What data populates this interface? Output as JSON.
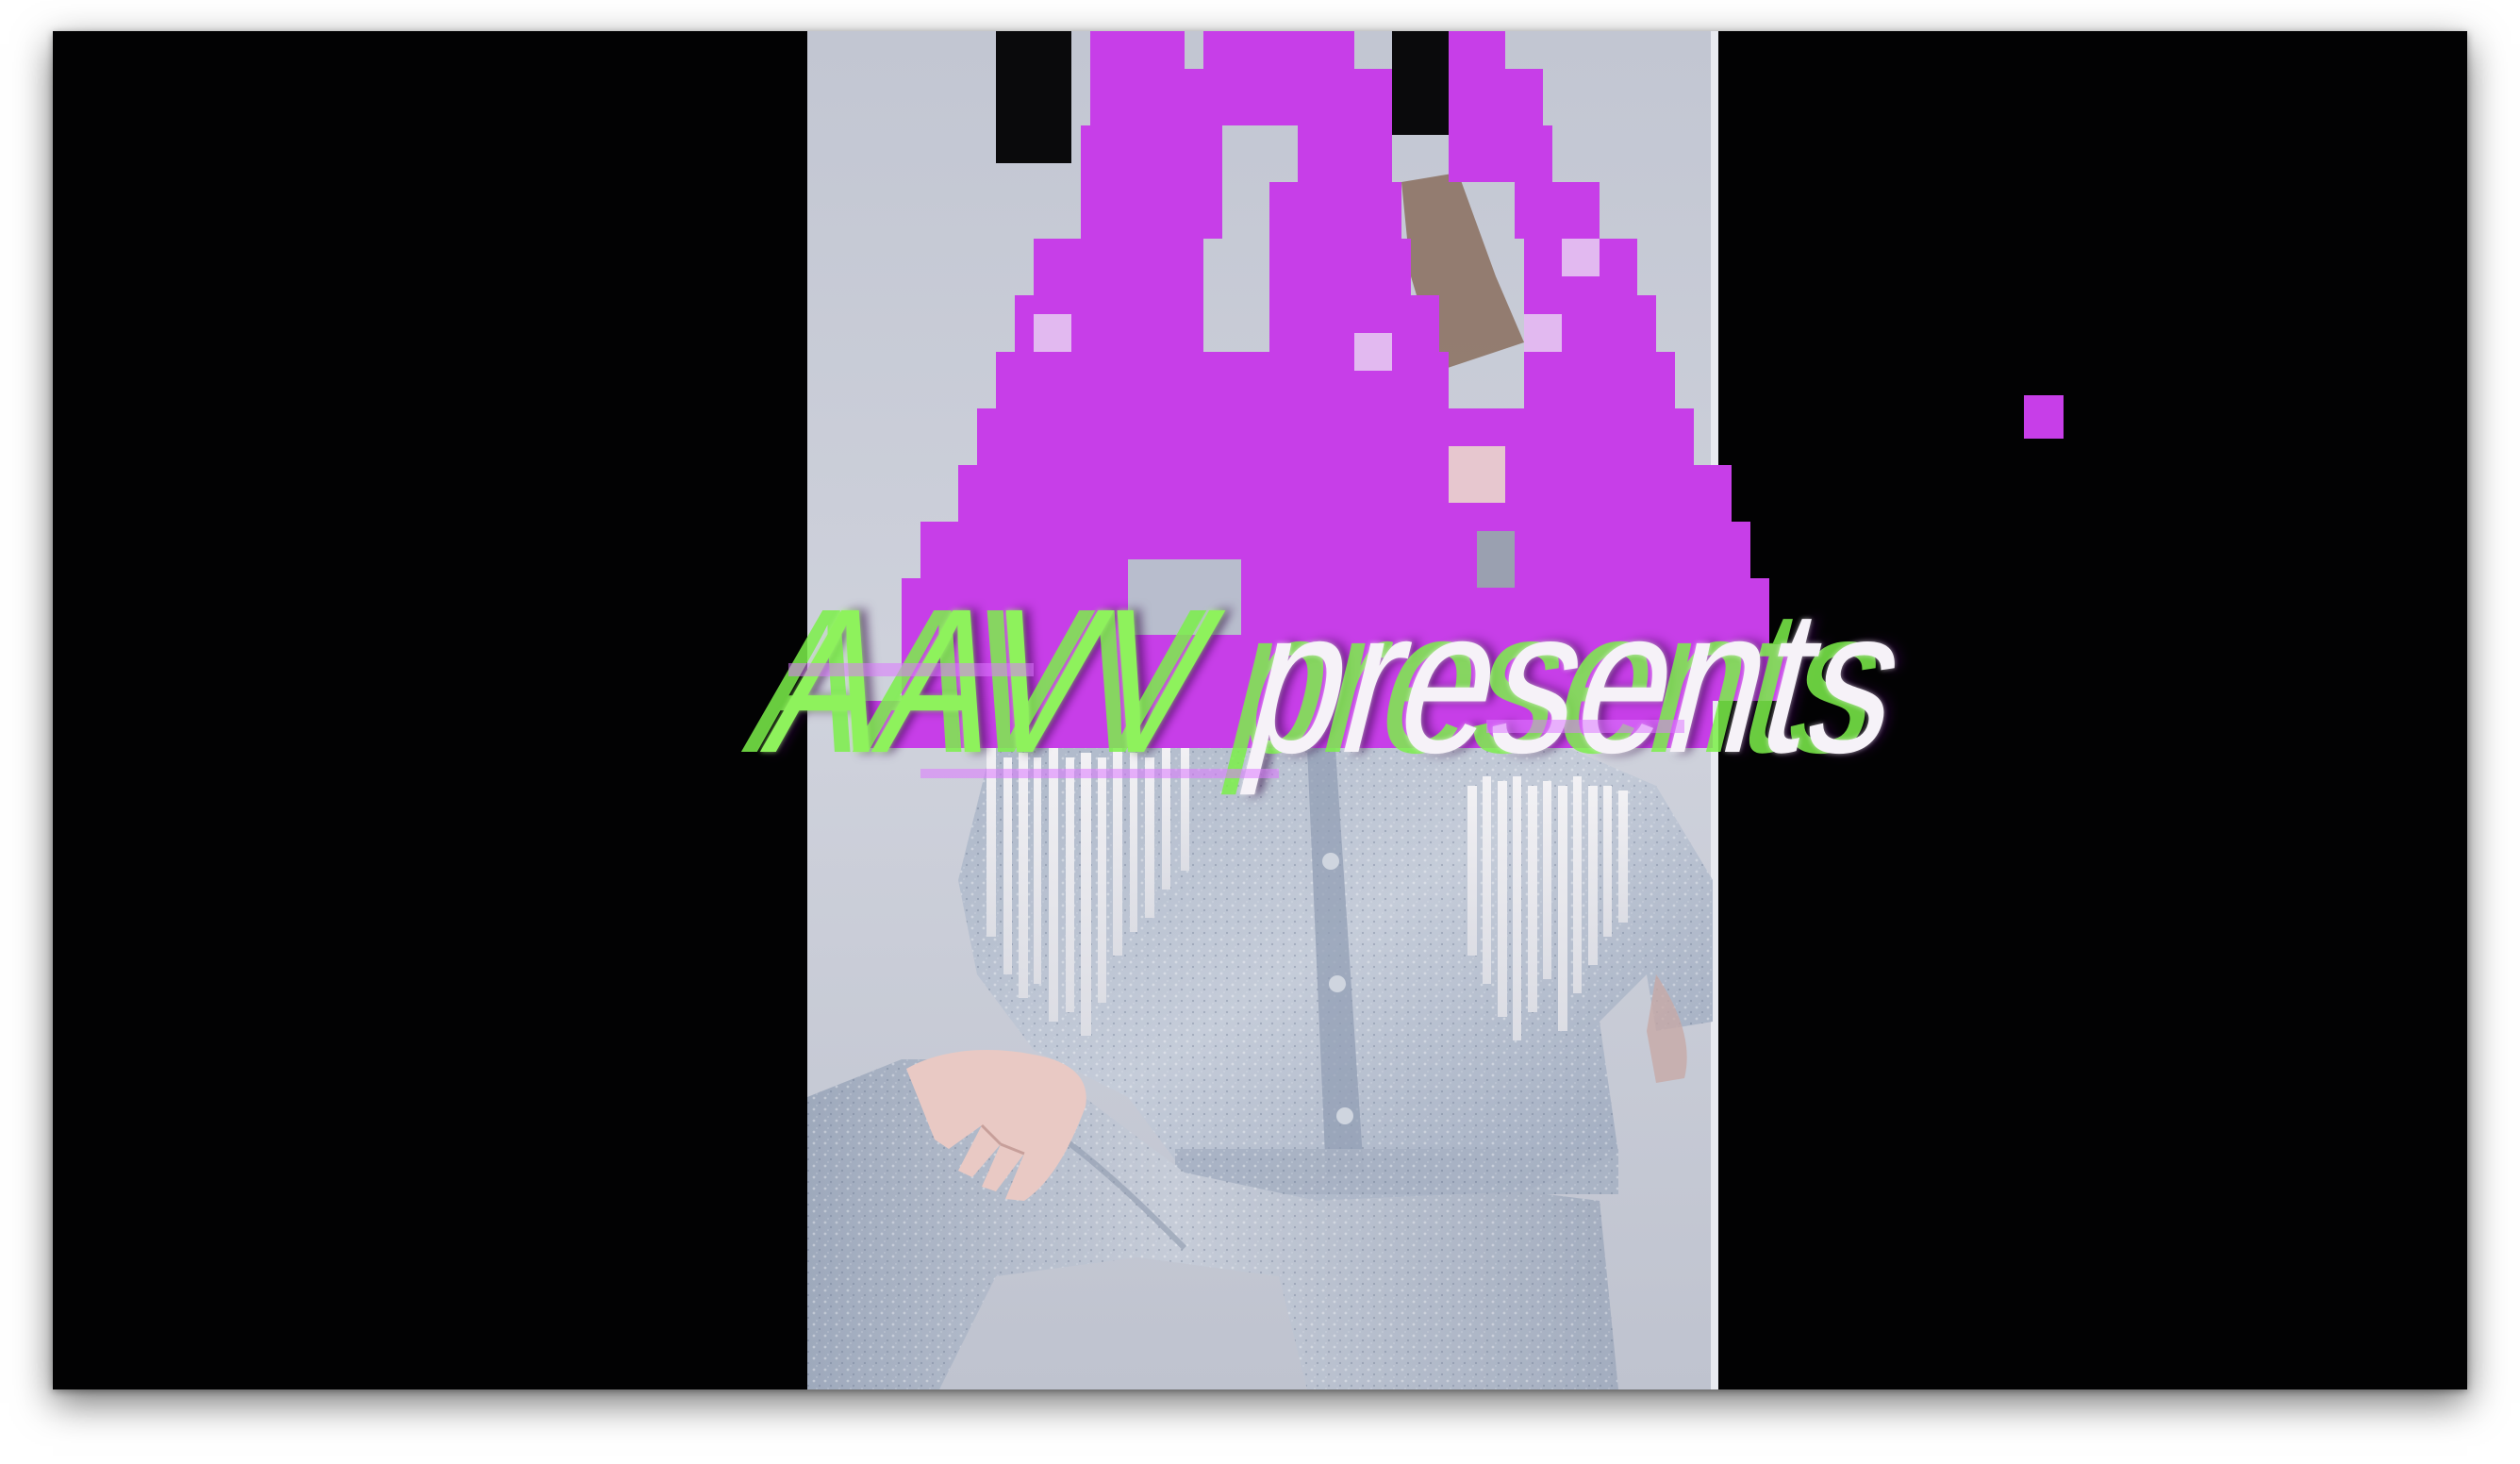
{
  "title": {
    "brand": "AAVV",
    "word": "presents"
  },
  "colors": {
    "background": "#020203",
    "accent_purple": "#c73ee8",
    "title_green": "#8ef25c",
    "title_white": "#f6f2f8",
    "backdrop_grey": "#c9ccd8"
  },
  "scene": {
    "backdrop": "grey studio photo panel",
    "subject": "model in acid-wash denim jacket with white fringe",
    "overlay_icon": "pixel-triangle-icon",
    "stray_pixel": "pixel-square-icon"
  }
}
